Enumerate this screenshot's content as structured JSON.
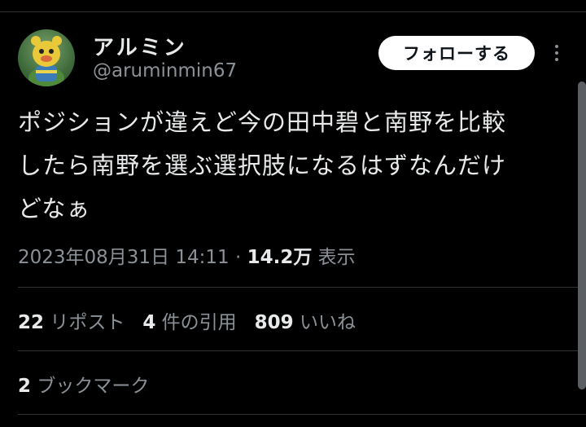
{
  "user": {
    "display_name": "アルミン",
    "handle": "@aruminmin67"
  },
  "follow_button": {
    "label": "フォローする"
  },
  "more_icon": "more-vertical-icon",
  "tweet": {
    "lines": [
      "ポジションが違えど今の田中碧と南野を比較",
      "したら南野を選ぶ選択肢になるはずなんだけ",
      "どなぁ"
    ]
  },
  "meta": {
    "datetime": "2023年08月31日 14:11",
    "separator": "·",
    "views": "14.2万",
    "views_label": "表示"
  },
  "stats": {
    "reposts": "22",
    "reposts_label": "リポスト",
    "quotes": "4",
    "quotes_label": "件の引用",
    "likes": "809",
    "likes_label": "いいね"
  },
  "bookmarks": {
    "count": "2",
    "label": "ブックマーク"
  },
  "colors": {
    "background": "#000000",
    "text": "#e7e9ea",
    "secondary": "#8b9197",
    "divider": "#2f3336",
    "button_bg": "#ffffff"
  }
}
